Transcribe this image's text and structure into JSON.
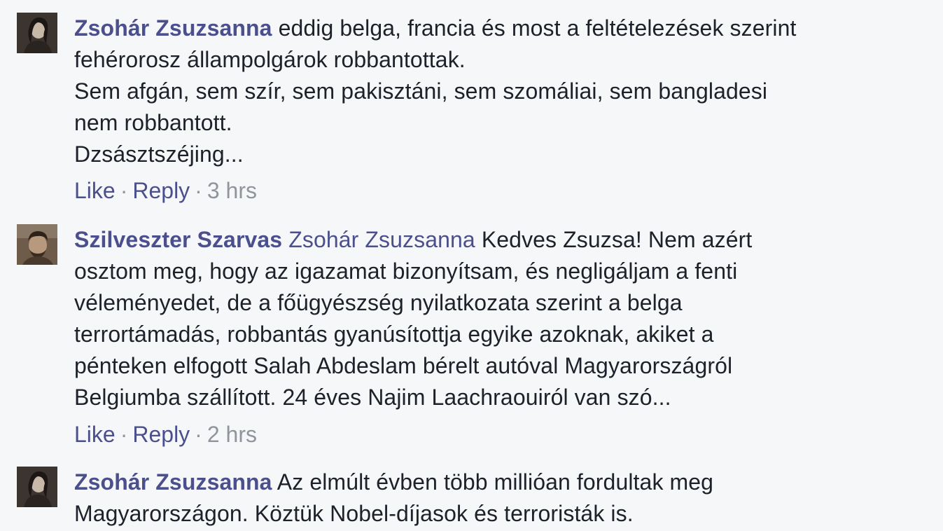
{
  "comments": [
    {
      "author": "Zsohár Zsuzsanna",
      "mention": "",
      "lines": [
        "eddig belga, francia és most a feltételezések szerint",
        "fehérorosz állampolgárok robbantottak.",
        "Sem afgán, sem szír, sem pakisztáni, sem szomáliai, sem bangladesi",
        "nem robbantott.",
        "Dzsásztszéjing..."
      ],
      "actions": {
        "like": "Like",
        "reply": "Reply",
        "separator": "·",
        "time": "3 hrs"
      }
    },
    {
      "author": "Szilveszter Szarvas",
      "mention": "Zsohár Zsuzsanna",
      "lines": [
        "Kedves Zsuzsa! Nem azért",
        "osztom meg, hogy az igazamat bizonyítsam, és negligáljam a fenti",
        "véleményedet, de a főügyészség nyilatkozata szerint a belga",
        "terrortámadás, robbantás gyanúsítottja egyike azoknak, akiket a",
        "pénteken elfogott Salah Abdeslam bérelt autóval Magyarországról",
        "Belgiumba szállított. 24 éves Najim Laachraouiról van szó..."
      ],
      "actions": {
        "like": "Like",
        "reply": "Reply",
        "separator": "·",
        "time": "2 hrs"
      }
    },
    {
      "author": "Zsohár Zsuzsanna",
      "mention": "",
      "lines": [
        "Az elmúlt évben több millióan fordultak meg",
        "Magyarországon. Köztük Nobel-díjasok és terroristák is."
      ]
    }
  ],
  "colors": {
    "background": "#f6f7f9",
    "link": "#4b4f8c",
    "text": "#1d2129",
    "meta": "#90949c"
  }
}
